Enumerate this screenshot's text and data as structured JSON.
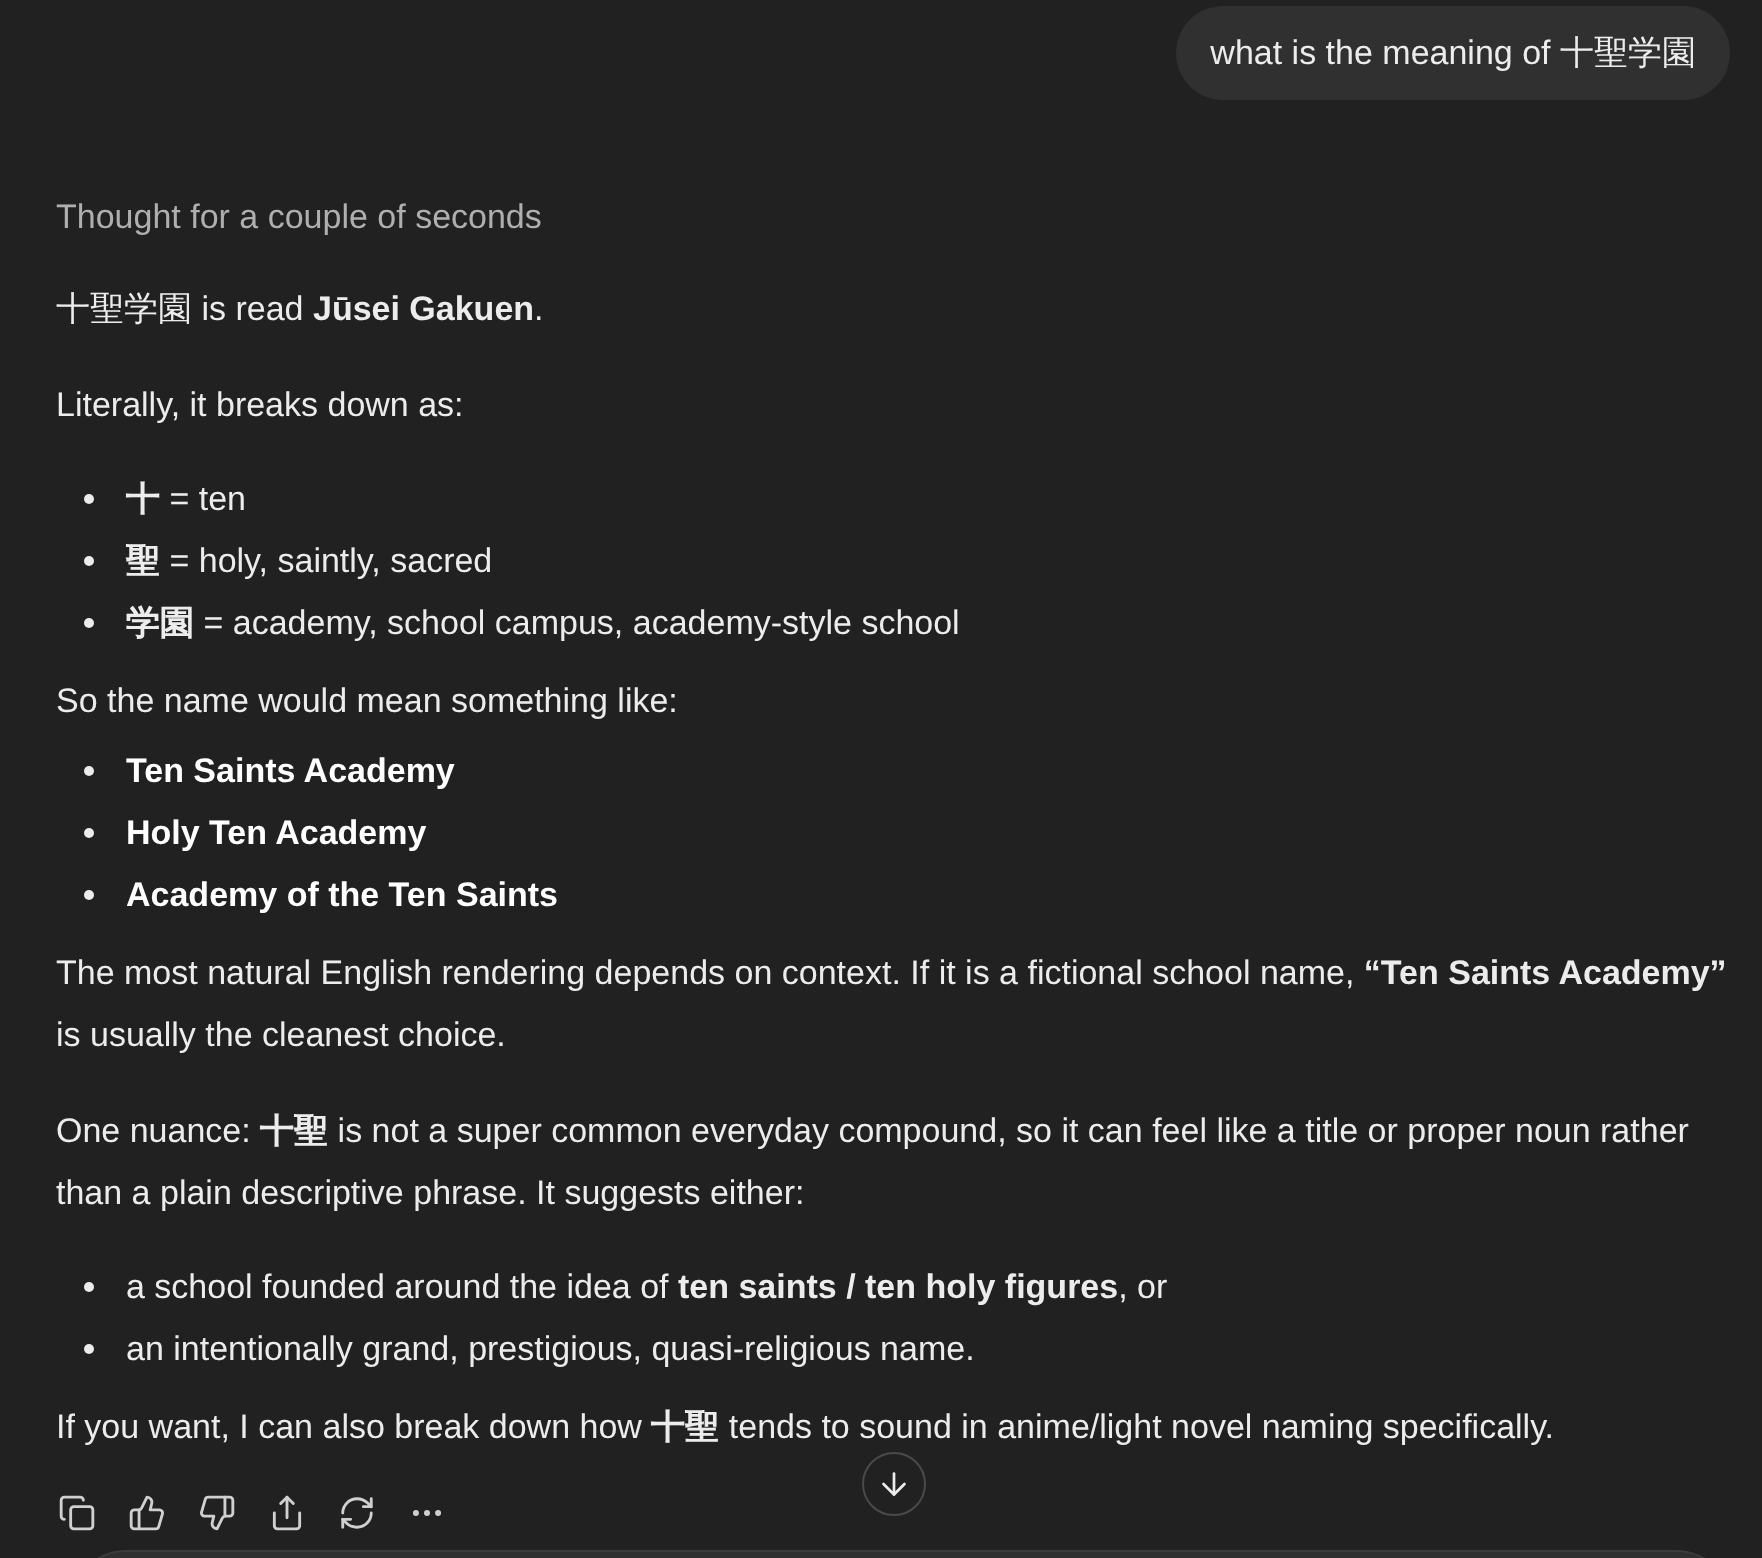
{
  "user_message": {
    "text": "what is the meaning of 十聖学園"
  },
  "response": {
    "thinking_label": "Thought for a couple of seconds",
    "blocks": [
      {
        "kind": "paragraph",
        "text": "十聖学園 is read **Jūsei Gakuen**."
      },
      {
        "kind": "paragraph",
        "text": "Literally, it breaks down as:"
      },
      {
        "kind": "list",
        "items": [
          "**十** = ten",
          "**聖** = holy, saintly, sacred",
          "**学園** = academy, school campus, academy-style school"
        ]
      },
      {
        "kind": "paragraph",
        "text": "So the name would mean something like:"
      },
      {
        "kind": "tight_list",
        "bold": true,
        "items": [
          "Ten Saints Academy",
          "Holy Ten Academy",
          "Academy of the Ten Saints"
        ]
      },
      {
        "kind": "paragraph",
        "text": "The most natural English rendering depends on context. If it is a fictional school name, **“Ten Saints Academy”** is usually the cleanest choice."
      },
      {
        "kind": "paragraph",
        "text": "One nuance: **十聖** is not a super common everyday compound, so it can feel like a title or proper noun rather than a plain descriptive phrase. It suggests either:"
      },
      {
        "kind": "list",
        "items": [
          "a school founded around the idea of **ten saints / ten holy figures**, or",
          "an intentionally grand, prestigious, quasi-religious name."
        ]
      },
      {
        "kind": "paragraph",
        "text": "If you want, I can also break down how **十聖** tends to sound in anime/light novel naming specifically."
      }
    ]
  }
}
